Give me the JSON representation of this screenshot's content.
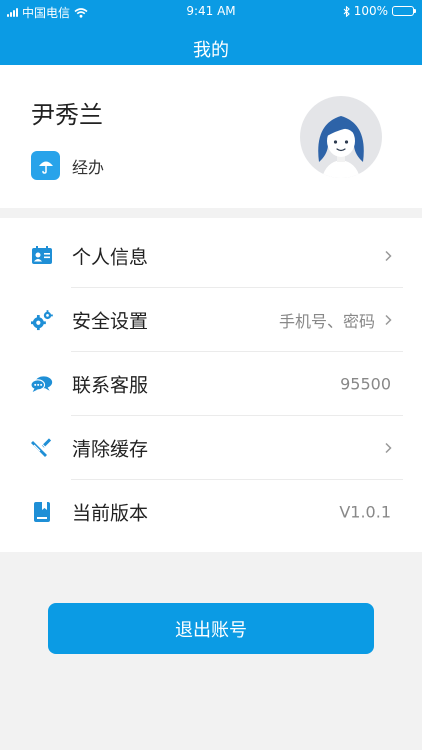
{
  "status_bar": {
    "carrier": "中国电信",
    "time": "9:41 AM",
    "battery": "100%"
  },
  "nav": {
    "title": "我的"
  },
  "profile": {
    "name": "尹秀兰",
    "role": "经办"
  },
  "menu": {
    "items": [
      {
        "label": "个人信息",
        "value": "",
        "icon": "id-card-icon",
        "chevron": true
      },
      {
        "label": "安全设置",
        "value": "手机号、密码",
        "icon": "gears-icon",
        "chevron": true
      },
      {
        "label": "联系客服",
        "value": "95500",
        "icon": "chat-icon",
        "chevron": false
      },
      {
        "label": "清除缓存",
        "value": "",
        "icon": "broom-icon",
        "chevron": true
      },
      {
        "label": "当前版本",
        "value": "V1.0.1",
        "icon": "book-icon",
        "chevron": false
      }
    ]
  },
  "logout": {
    "label": "退出账号"
  },
  "colors": {
    "accent": "#0b9be4",
    "icon_blue": "#1f8fd6",
    "avatar_hair": "#2d63a8"
  }
}
